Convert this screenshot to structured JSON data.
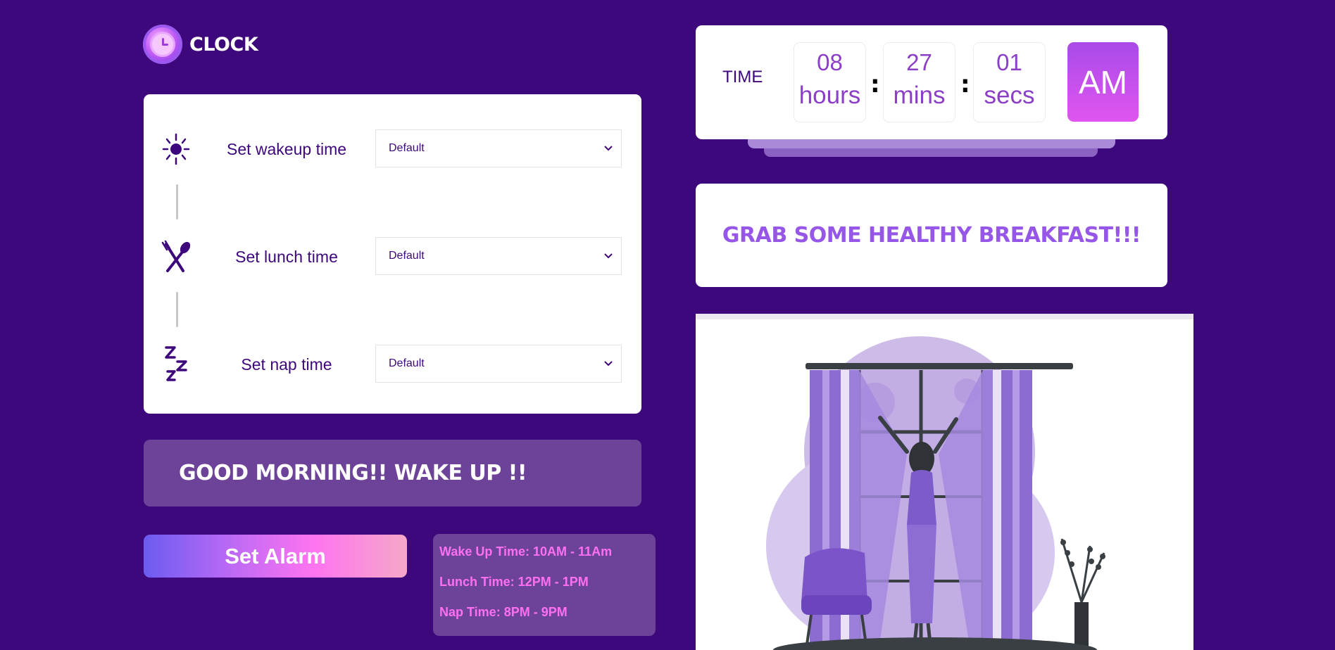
{
  "app": {
    "title": "CLOCK"
  },
  "settings": {
    "rows": [
      {
        "label": "Set wakeup time",
        "icon": "sun-icon",
        "value": "Default"
      },
      {
        "label": "Set lunch time",
        "icon": "fork-spoon-icon",
        "value": "Default"
      },
      {
        "label": "Set nap time",
        "icon": "zzz-icon",
        "value": "Default"
      }
    ]
  },
  "greeting": {
    "text": "GOOD MORNING!! WAKE UP !!"
  },
  "alarm_button": {
    "label": "Set Alarm"
  },
  "schedule": {
    "items": [
      "Wake Up Time: 10AM - 11Am",
      "Lunch Time: 12PM - 1PM",
      "Nap Time: 8PM - 9PM"
    ]
  },
  "clock": {
    "label": "TIME",
    "hours": "08",
    "hours_unit": "hours",
    "mins": "27",
    "mins_unit": "mins",
    "secs": "01",
    "secs_unit": "secs",
    "separator": ":",
    "period": "AM"
  },
  "message": {
    "text": "GRAB SOME HEALTHY BREAKFAST!!!"
  },
  "colors": {
    "background": "#3d087b",
    "accent": "#9657e8",
    "pink": "#ff6ff2",
    "panel": "#6c4398"
  },
  "illustration": {
    "name": "woman-opening-curtains-illustration"
  }
}
